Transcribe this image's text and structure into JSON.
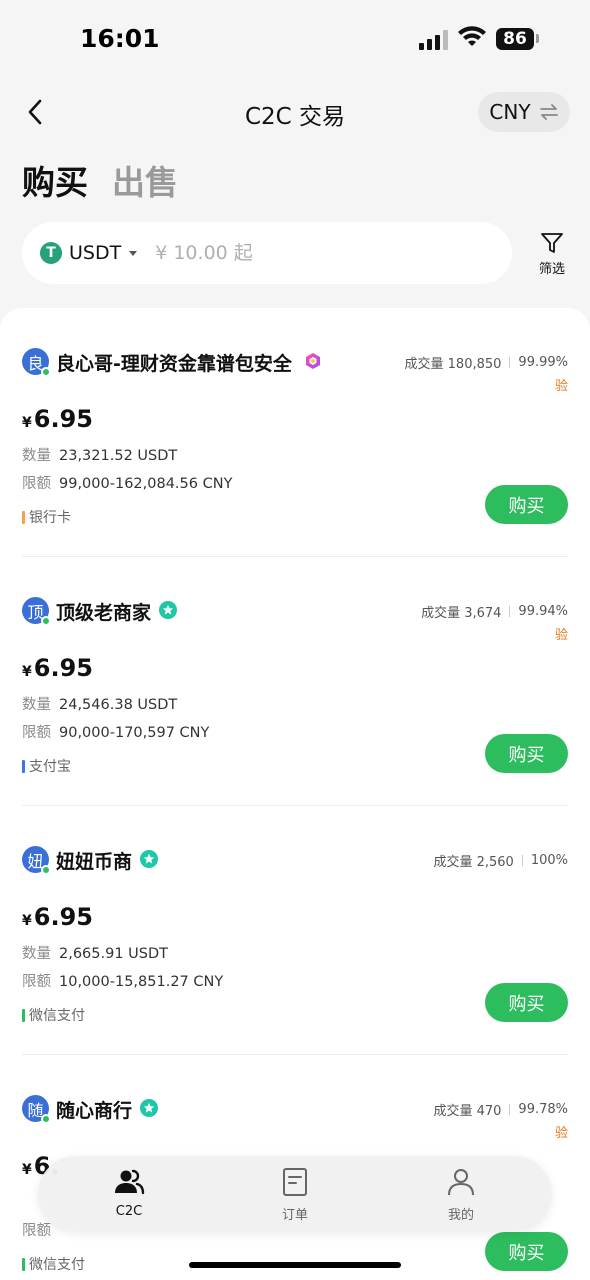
{
  "status_bar": {
    "time": "16:01",
    "battery": "86"
  },
  "header": {
    "title": "C2C 交易",
    "currency": "CNY"
  },
  "tabs": {
    "buy": "购买",
    "sell": "出售"
  },
  "search": {
    "asset": "USDT",
    "asset_icon": "T",
    "placeholder": "¥ 10.00 起"
  },
  "filter": {
    "label": "筛选"
  },
  "labels": {
    "quantity": "数量",
    "limit": "限额",
    "currency_symbol": "¥",
    "buy_button": "购买"
  },
  "listings": [
    {
      "avatar": "良",
      "name": "良心哥-理财资金靠谱包安全",
      "badge": "hex-badge",
      "volume": "成交量 180,850",
      "rate": "99.99%",
      "verify": "验",
      "price": "6.95",
      "quantity": "23,321.52 USDT",
      "limit": "99,000-162,084.56 CNY",
      "payment": "银行卡",
      "payment_color": "#f5a24a"
    },
    {
      "avatar": "顶",
      "name": "顶级老商家",
      "badge": "star-badge",
      "volume": "成交量 3,674",
      "rate": "99.94%",
      "verify": "验",
      "price": "6.95",
      "quantity": "24,546.38 USDT",
      "limit": "90,000-170,597 CNY",
      "payment": "支付宝",
      "payment_color": "#3b74e8"
    },
    {
      "avatar": "妞",
      "name": "妞妞币商",
      "badge": "star-badge",
      "volume": "成交量 2,560",
      "rate": "100%",
      "verify": "",
      "price": "6.95",
      "quantity": "2,665.91 USDT",
      "limit": "10,000-15,851.27 CNY",
      "payment": "微信支付",
      "payment_color": "#2dbd5e"
    },
    {
      "avatar": "随",
      "name": "随心商行",
      "badge": "star-badge",
      "volume": "成交量 470",
      "rate": "99.78%",
      "verify": "验",
      "price": "6.",
      "quantity": "",
      "limit": "",
      "payment": "微信支付",
      "payment_color": "#2dbd5e"
    }
  ],
  "bottom_nav": {
    "items": [
      {
        "label": "C2C",
        "icon": "users-icon",
        "active": true
      },
      {
        "label": "订单",
        "icon": "order-icon",
        "active": false
      },
      {
        "label": "我的",
        "icon": "profile-icon",
        "active": false
      }
    ]
  },
  "colors": {
    "accent": "#2dbd5e",
    "verify": "#e07a1f",
    "badge": "#1fc6a8",
    "avatar": "#3b6fd8"
  }
}
